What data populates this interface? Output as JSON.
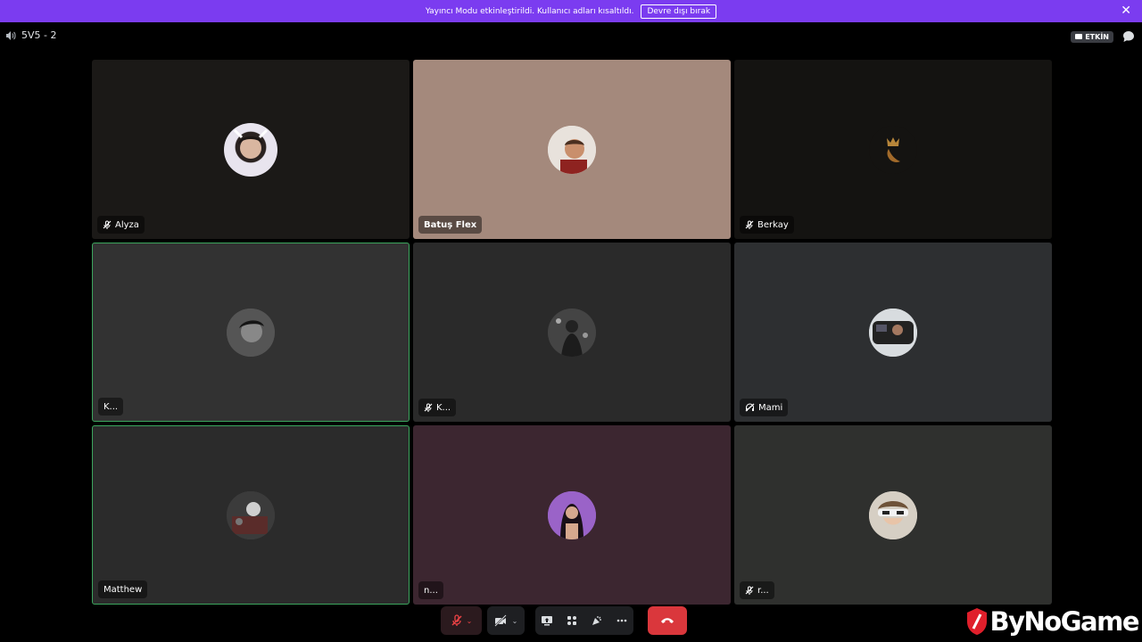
{
  "banner": {
    "message": "Yayıncı Modu etkinleştirildi. Kullanıcı adları kısaltıldı.",
    "button_label": "Devre dışı bırak"
  },
  "channel": {
    "name": "5V5 - 2"
  },
  "top_right": {
    "live_label": "ETKİN"
  },
  "participants": [
    {
      "name": "Alyza",
      "muted": true
    },
    {
      "name": "Batuş Flex",
      "muted": false
    },
    {
      "name": "Berkay",
      "muted": true
    },
    {
      "name": "K...",
      "muted": false,
      "speaking": true
    },
    {
      "name": "K...",
      "muted": true
    },
    {
      "name": "Mami",
      "muted": false,
      "deafened": true
    },
    {
      "name": "Matthew",
      "muted": false,
      "speaking": true
    },
    {
      "name": "n...",
      "muted": false
    },
    {
      "name": "r...",
      "muted": true
    }
  ],
  "watermark": {
    "text": "ByNoGame"
  },
  "colors": {
    "banner": "#7b3cf0",
    "speaking": "#3ba55d",
    "end_call": "#da373c"
  },
  "controls": {
    "icons": [
      "mic-muted-icon",
      "camera-off-icon",
      "screen-share-icon",
      "activities-icon",
      "soundboard-icon",
      "more-icon",
      "end-call-icon"
    ]
  }
}
